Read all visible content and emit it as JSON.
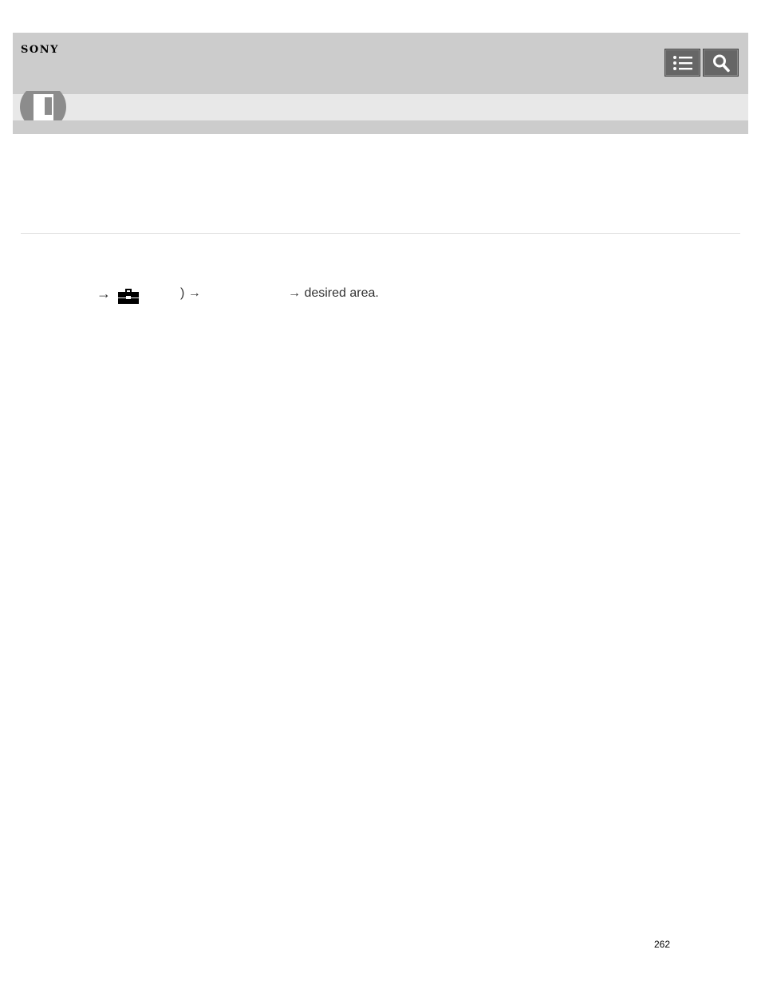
{
  "header": {
    "brand": "SONY",
    "buttons": [
      {
        "label": "Table of contents",
        "icon": "list-icon"
      },
      {
        "label": "Search",
        "icon": "search-icon"
      }
    ]
  },
  "badge": {
    "icon": "book-icon"
  },
  "instruction": {
    "arrow_1": "→",
    "menu_icon": "toolbox-icon",
    "segment_2": ") →",
    "segment_3": "→ desired area."
  },
  "footer": {
    "page_number": "262"
  },
  "colors": {
    "header_bg": "#cccccc",
    "subband_bg": "#e8e8e8",
    "button_bg": "#666666",
    "badge_bg": "#8c8c8c",
    "text": "#333333"
  }
}
